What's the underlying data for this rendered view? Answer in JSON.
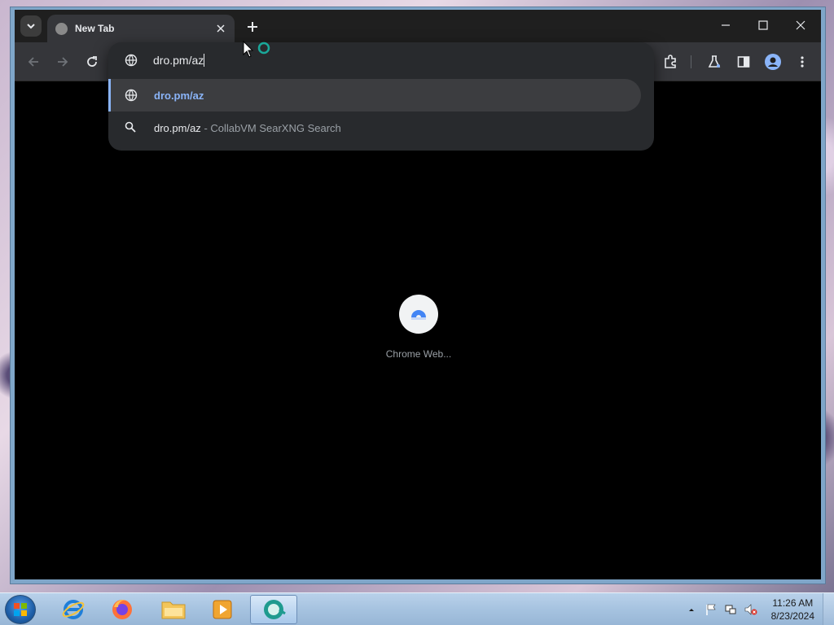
{
  "browser": {
    "tab": {
      "title": "New Tab"
    },
    "omnibox": {
      "input_value": "dro.pm/az",
      "suggestions": [
        {
          "text": "dro.pm/az",
          "subtext": ""
        },
        {
          "text": "dro.pm/az",
          "subtext": "- CollabVM SearXNG Search"
        }
      ]
    },
    "shortcuts": [
      {
        "label": "Chrome Web..."
      }
    ]
  },
  "taskbar": {
    "clock": {
      "time": "11:26 AM",
      "date": "8/23/2024"
    }
  },
  "colors": {
    "accent": "#8ab4f8",
    "chrome_bg": "#35363a",
    "content_bg": "#000000"
  }
}
